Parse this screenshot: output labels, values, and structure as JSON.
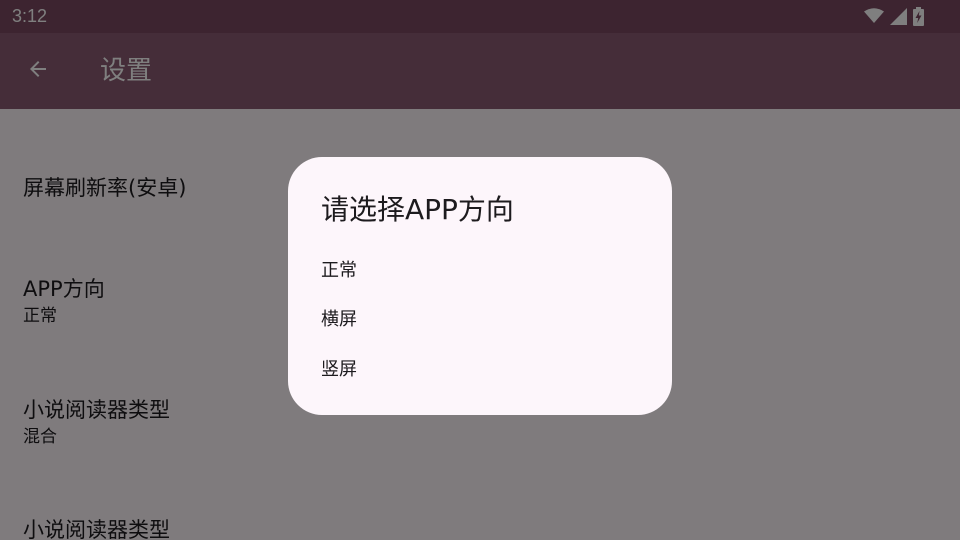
{
  "status_bar": {
    "time": "3:12",
    "icons": [
      "wifi-icon",
      "signal-icon",
      "battery-charging-icon"
    ]
  },
  "app_bar": {
    "back_icon": "arrow-left-icon",
    "title": "设置"
  },
  "settings": [
    {
      "title": "屏幕刷新率(安卓)",
      "value": ""
    },
    {
      "title": "APP方向",
      "value": "正常"
    },
    {
      "title": "小说阅读器类型",
      "value": "混合"
    },
    {
      "title": "小说阅读器类型",
      "value": ""
    }
  ],
  "dialog": {
    "title": "请选择APP方向",
    "options": [
      "正常",
      "横屏",
      "竖屏"
    ]
  },
  "colors": {
    "status_bar": "#7a4860",
    "app_bar": "#8b5a73",
    "background": "#fff7fb",
    "dialog": "#fdf6fb",
    "text": "#1d1b1e"
  }
}
